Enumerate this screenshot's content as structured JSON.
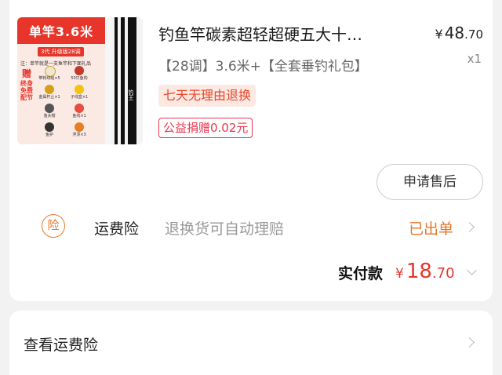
{
  "product": {
    "thumbnail": {
      "banner": "单竿3.6米",
      "sub_banner": "3代 升级版28调",
      "note": "注：单竿就是一支鱼竿和下面礼品",
      "gift_text": "赠",
      "side_text": "终身免费配节",
      "items": [
        "带钩线组×5",
        "50只鱼钩",
        "金属杆止×1",
        "子线盒×1",
        "渔夫帽",
        "鱼线×1",
        "鱼护",
        "浮漂×3"
      ],
      "rod_mark": "钓王"
    },
    "title": "钓鱼竿碳素超轻超硬五大十…",
    "spec": "【28调】3.6米+【全套垂钓礼包】",
    "price_currency": "¥",
    "price_integer": "48",
    "price_decimal": ".70",
    "quantity": "x1",
    "tag_return": "七天无理由退换",
    "tag_charity": "公益捐赠0.02元",
    "after_sale_button": "申请售后"
  },
  "shipping_insurance": {
    "icon_char": "险",
    "icon_name": "insurance-icon",
    "label": "运费险",
    "description": "退换货可自动理赔",
    "status": "已出单",
    "status_color": "#e8782b"
  },
  "payment": {
    "label": "实付款",
    "currency": "¥",
    "integer": "18",
    "decimal": ".70",
    "amount_color": "#e8352b"
  },
  "link": {
    "label": "查看运费险"
  }
}
